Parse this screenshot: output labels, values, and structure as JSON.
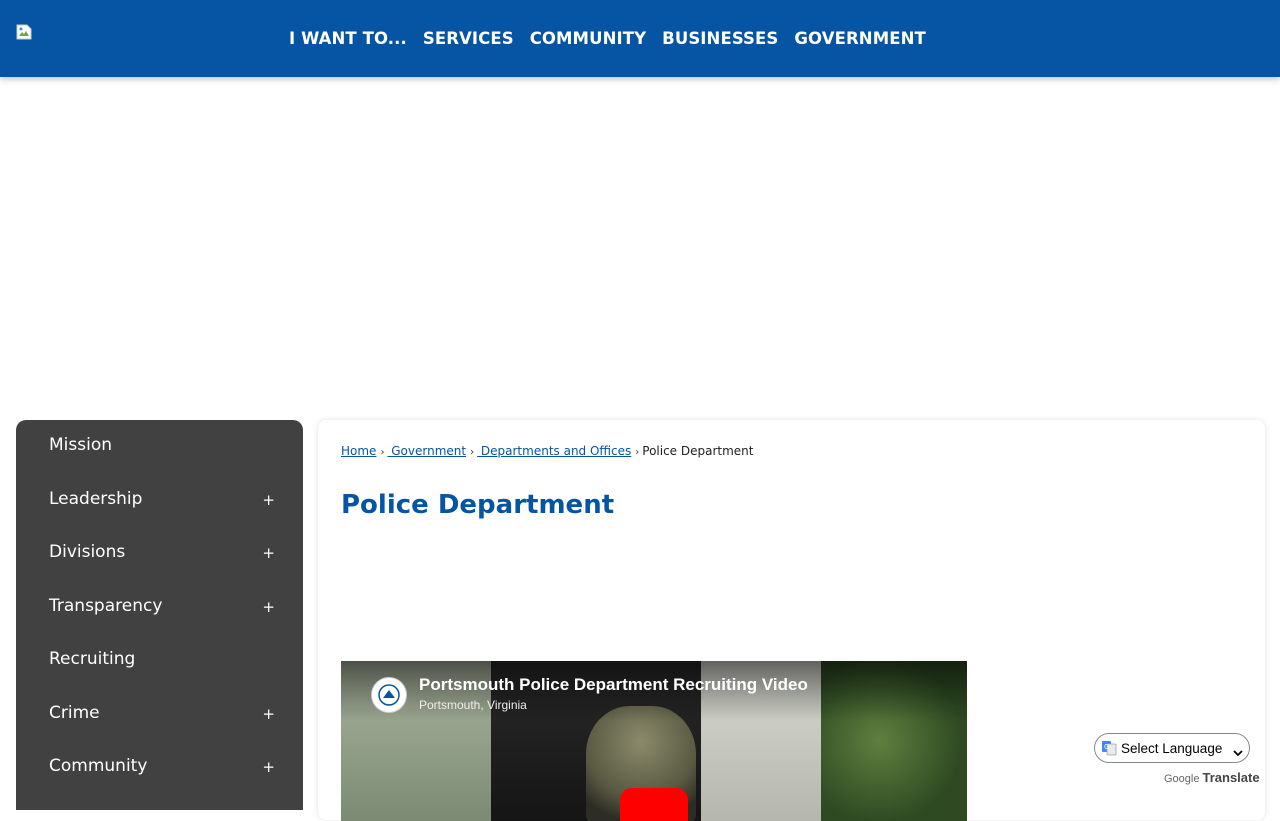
{
  "header": {
    "logo_icon": "broken-image-icon",
    "nav": [
      {
        "label": "I WANT TO..."
      },
      {
        "label": "SERVICES"
      },
      {
        "label": "COMMUNITY"
      },
      {
        "label": "BUSINESSES"
      },
      {
        "label": "GOVERNMENT"
      }
    ]
  },
  "sidebar": {
    "items": [
      {
        "label": "Mission",
        "expandable": false
      },
      {
        "label": "Leadership",
        "expandable": true,
        "toggle": "+"
      },
      {
        "label": "Divisions",
        "expandable": true,
        "toggle": "+"
      },
      {
        "label": "Transparency",
        "expandable": true,
        "toggle": "+"
      },
      {
        "label": "Recruiting",
        "expandable": false
      },
      {
        "label": "Crime",
        "expandable": true,
        "toggle": "+"
      },
      {
        "label": "Community",
        "expandable": true,
        "toggle": "+"
      }
    ]
  },
  "breadcrumb": {
    "items": [
      {
        "label": "Home"
      },
      {
        "label": " Government"
      },
      {
        "label": " Departments and Offices"
      }
    ],
    "current": "Police Department",
    "separator": "›"
  },
  "page": {
    "title": "Police Department"
  },
  "video": {
    "title": "Portsmouth Police Department Recruiting Video",
    "subtitle": "Portsmouth, Virginia",
    "play_color": "#ff0000"
  },
  "translate": {
    "select_label": "Select Language",
    "powered_by": "Google",
    "translate_label": "Translate"
  },
  "colors": {
    "brand_blue": "#0654a4",
    "sidebar_bg": "#414141"
  }
}
